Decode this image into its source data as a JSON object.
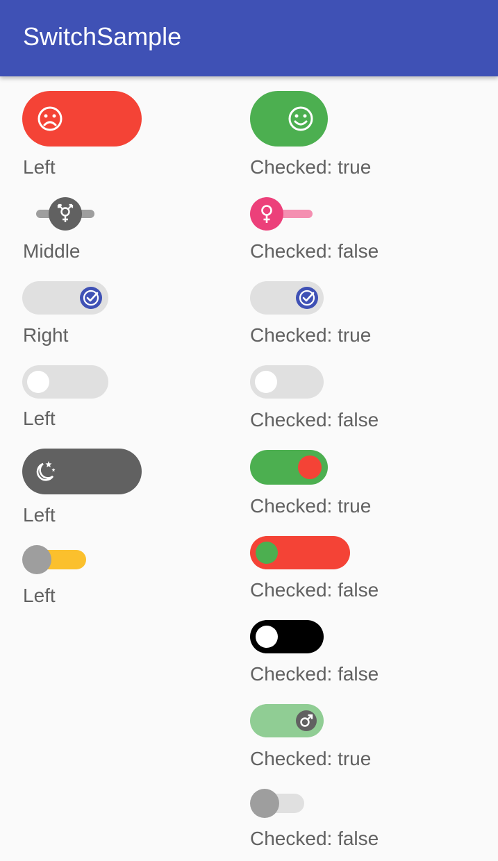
{
  "app": {
    "title": "SwitchSample"
  },
  "left_column": {
    "labels": [
      "Left",
      "Middle",
      "Right",
      "Left",
      "Left",
      "Left"
    ]
  },
  "right_column": {
    "labels": [
      "Checked: true",
      "Checked: false",
      "Checked: true",
      "Checked: false",
      "Checked: true",
      "Checked: false",
      "Checked: false",
      "Checked: true",
      "Checked: false"
    ]
  },
  "switches": {
    "left": [
      {
        "state": "left",
        "icon": "sad-face-icon",
        "track_color": "#f44336",
        "thumb_color": "#f44336"
      },
      {
        "state": "middle",
        "icon": "transgender-icon",
        "track_color": "#9e9e9e",
        "thumb_color": "#616161"
      },
      {
        "state": "right",
        "icon": "check-circle-icon",
        "track_color": "#e0e0e0",
        "thumb_color": "#3f51b5"
      },
      {
        "state": "left",
        "icon": "none",
        "track_color": "#e0e0e0",
        "thumb_color": "#ffffff"
      },
      {
        "state": "left",
        "icon": "moon-stars-icon",
        "track_color": "#616161",
        "thumb_color": "#616161"
      },
      {
        "state": "left",
        "icon": "none",
        "track_color": "#fbc02d",
        "thumb_color": "#9e9e9e"
      }
    ],
    "right": [
      {
        "checked": true,
        "icon": "smile-face-icon",
        "track_color": "#4caf50",
        "thumb_color": "#4caf50"
      },
      {
        "checked": false,
        "icon": "female-icon",
        "track_color": "#f48fb1",
        "thumb_color": "#ec407a"
      },
      {
        "checked": true,
        "icon": "check-circle-icon",
        "track_color": "#e0e0e0",
        "thumb_color": "#3f51b5"
      },
      {
        "checked": false,
        "icon": "none",
        "track_color": "#e0e0e0",
        "thumb_color": "#ffffff"
      },
      {
        "checked": true,
        "icon": "none",
        "track_color": "#4caf50",
        "thumb_color": "#f44336"
      },
      {
        "checked": false,
        "icon": "none",
        "track_color": "#f44336",
        "thumb_color": "#4caf50"
      },
      {
        "checked": false,
        "icon": "none",
        "track_color": "#000000",
        "thumb_color": "#ffffff"
      },
      {
        "checked": true,
        "icon": "male-icon",
        "track_color": "#90cd94",
        "thumb_color": "#616161"
      },
      {
        "checked": false,
        "icon": "none",
        "track_color": "#e0e0e0",
        "thumb_color": "#9e9e9e"
      }
    ]
  }
}
